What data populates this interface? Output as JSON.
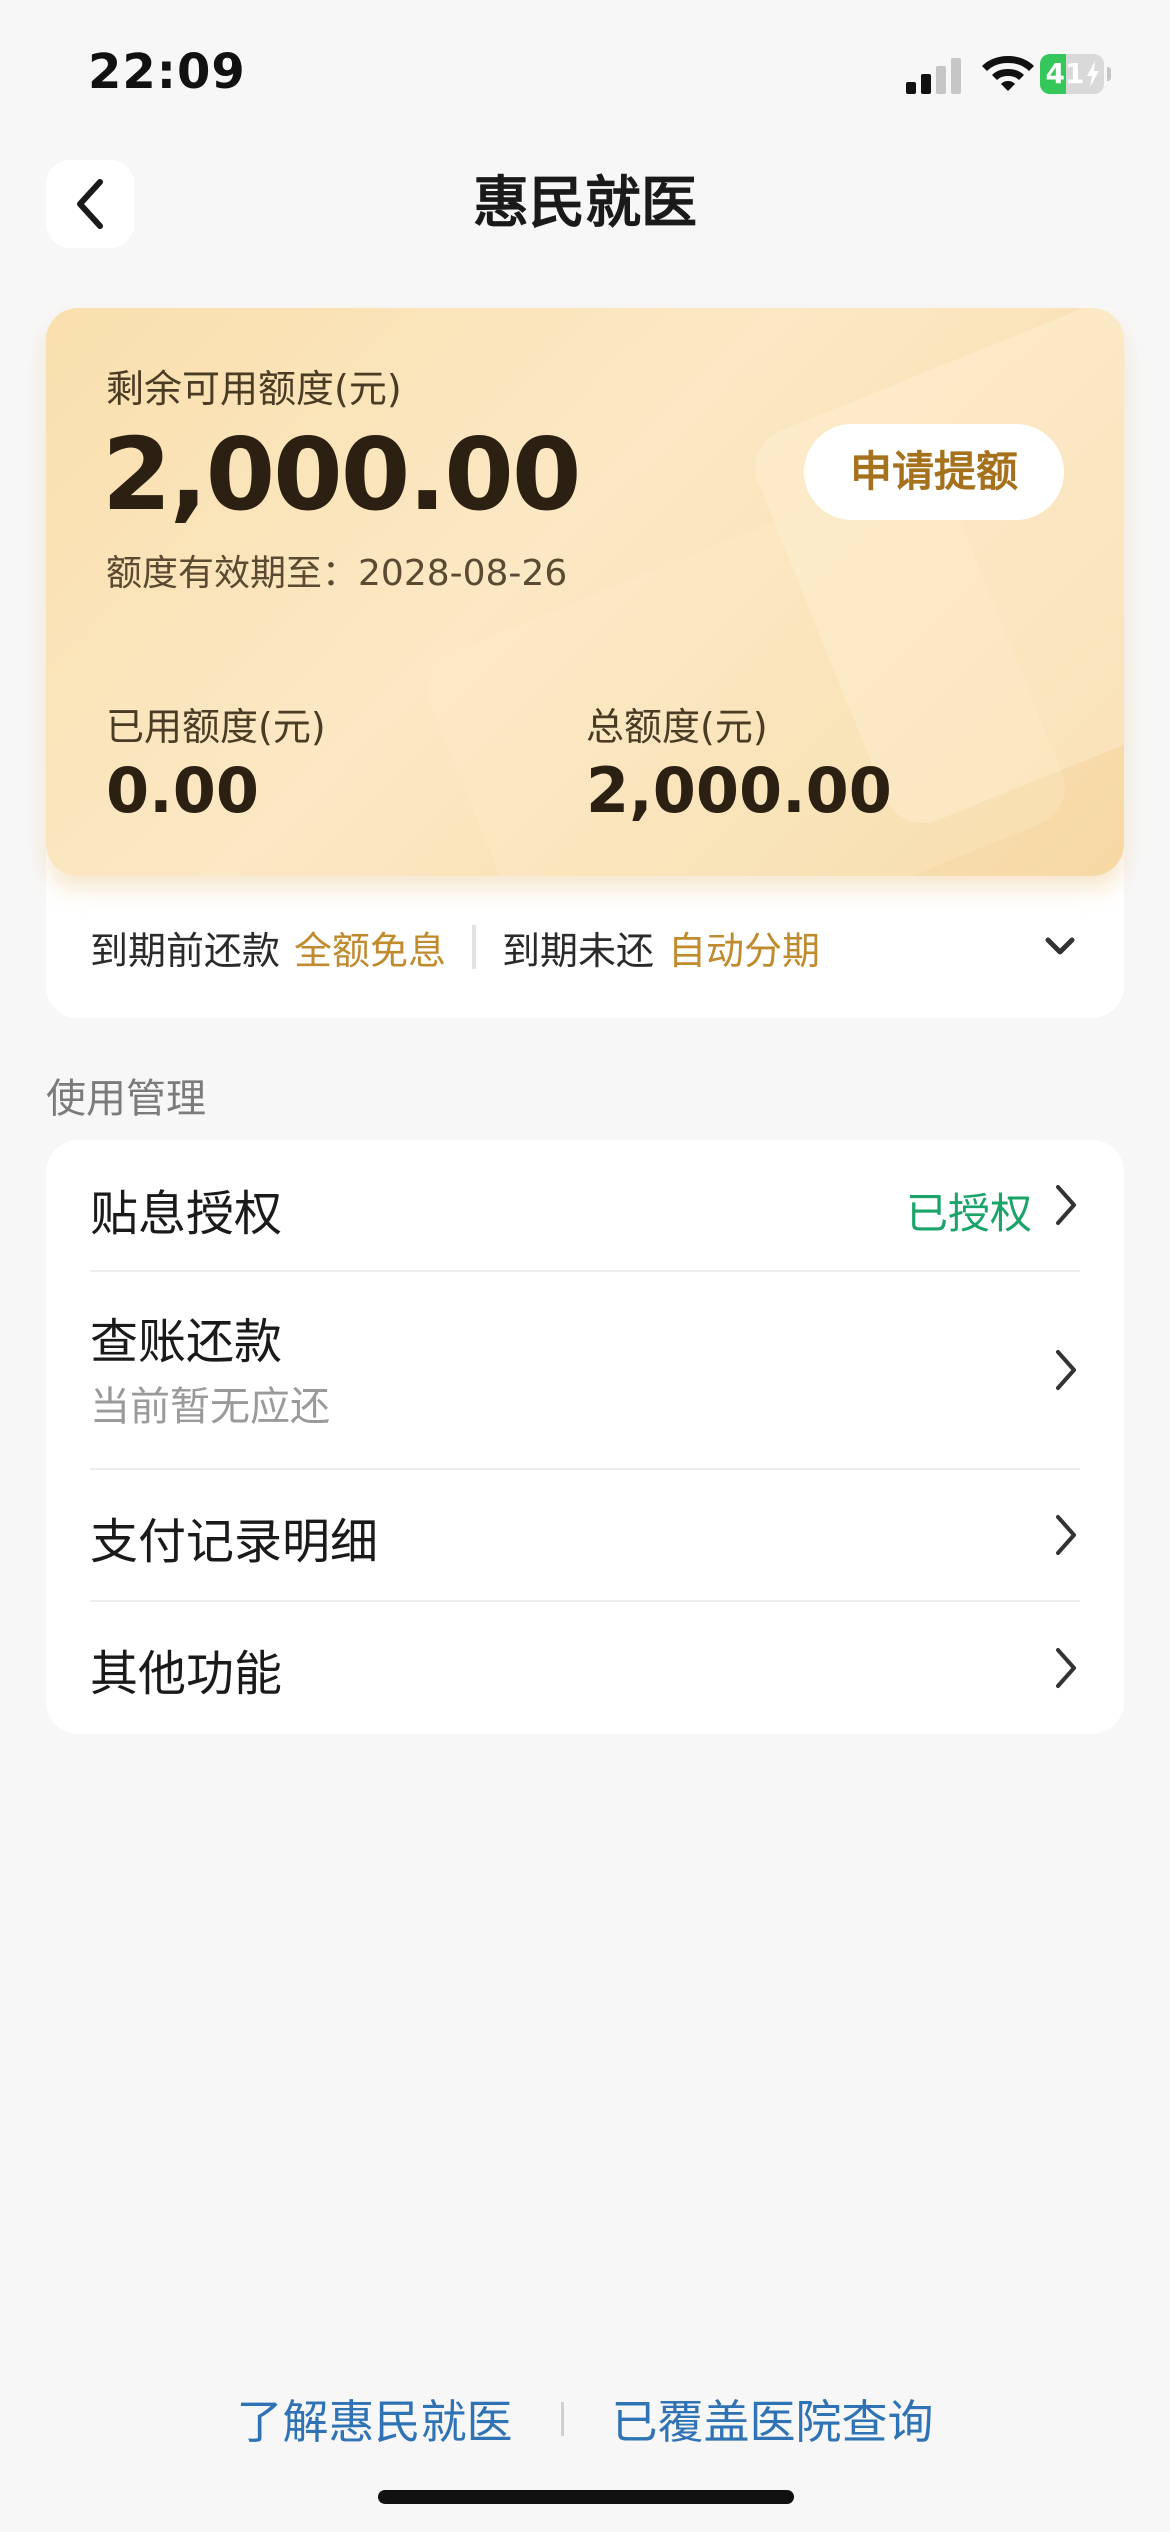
{
  "status_bar": {
    "time": "22:09",
    "battery_percent": "41",
    "battery_level": 0.41,
    "battery_color": "#34c759"
  },
  "nav": {
    "title": "惠民就医",
    "back_icon": "chevron-left-icon"
  },
  "credit": {
    "remaining_label": "剩余可用额度(元)",
    "remaining_amount": "2,000.00",
    "expiry_label": "额度有效期至：",
    "expiry_date": "2028-08-26",
    "apply_button": "申请提额",
    "used_label": "已用额度(元)",
    "used_amount": "0.00",
    "total_label": "总额度(元)",
    "total_amount": "2,000.00",
    "accent_color": "#c08a2e"
  },
  "repayment": {
    "before_due_label": "到期前还款",
    "before_due_value": "全额免息",
    "after_due_label": "到期未还",
    "after_due_value": "自动分期",
    "expand_icon": "chevron-down-icon"
  },
  "management": {
    "section_title": "使用管理",
    "items": [
      {
        "label": "贴息授权",
        "status": "已授权",
        "status_color": "#1aa46a"
      },
      {
        "label": "查账还款",
        "sub": "当前暂无应还"
      },
      {
        "label": "支付记录明细"
      },
      {
        "label": "其他功能"
      }
    ]
  },
  "footer": {
    "link_about": "了解惠民就医",
    "link_hospitals": "已覆盖医院查询",
    "link_color": "#2f73b5"
  }
}
